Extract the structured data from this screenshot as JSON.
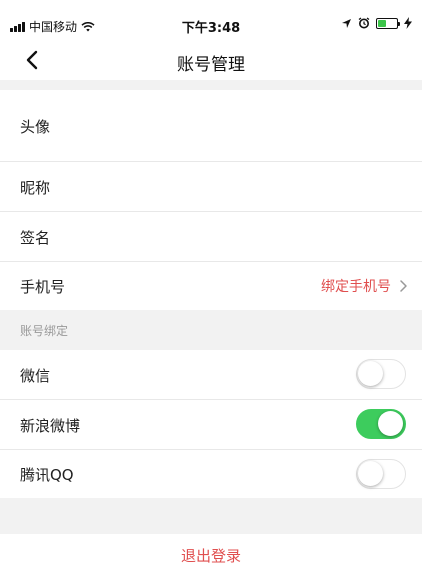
{
  "status_bar": {
    "carrier": "中国移动",
    "time": "下午3:48"
  },
  "nav": {
    "title": "账号管理"
  },
  "profile": {
    "avatar_label": "头像",
    "nickname_label": "昵称",
    "signature_label": "签名",
    "phone_label": "手机号",
    "phone_action": "绑定手机号"
  },
  "bindings": {
    "section_title": "账号绑定",
    "items": [
      {
        "label": "微信",
        "enabled": false
      },
      {
        "label": "新浪微博",
        "enabled": true
      },
      {
        "label": "腾讯QQ",
        "enabled": false
      }
    ]
  },
  "logout_label": "退出登录",
  "colors": {
    "accent_red": "#e04f4f",
    "toggle_on": "#3dcc5d",
    "battery": "#3cc54a"
  }
}
